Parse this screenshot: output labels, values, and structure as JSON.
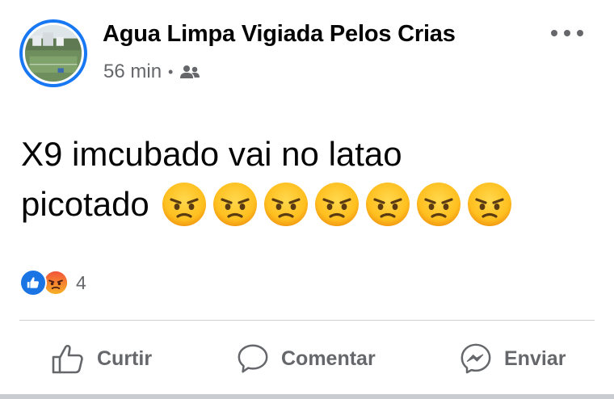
{
  "header": {
    "group_name": "Agua Limpa Vigiada Pelos Crias",
    "time": "56 min",
    "separator": "•",
    "audience_icon": "group-icon",
    "more_icon": "more-dots-icon"
  },
  "content": {
    "line1": "X9 imcubado vai no latao",
    "line2": "picotado",
    "emoji": "angry-face-emoji",
    "emoji_count": 7
  },
  "reactions": {
    "icons": [
      "like-reaction-icon",
      "angry-reaction-icon"
    ],
    "count": "4"
  },
  "actions": {
    "like_label": "Curtir",
    "comment_label": "Comentar",
    "send_label": "Enviar"
  },
  "colors": {
    "brand_blue": "#1877f2",
    "secondary_text": "#65676b",
    "divider": "#ced0d4"
  }
}
